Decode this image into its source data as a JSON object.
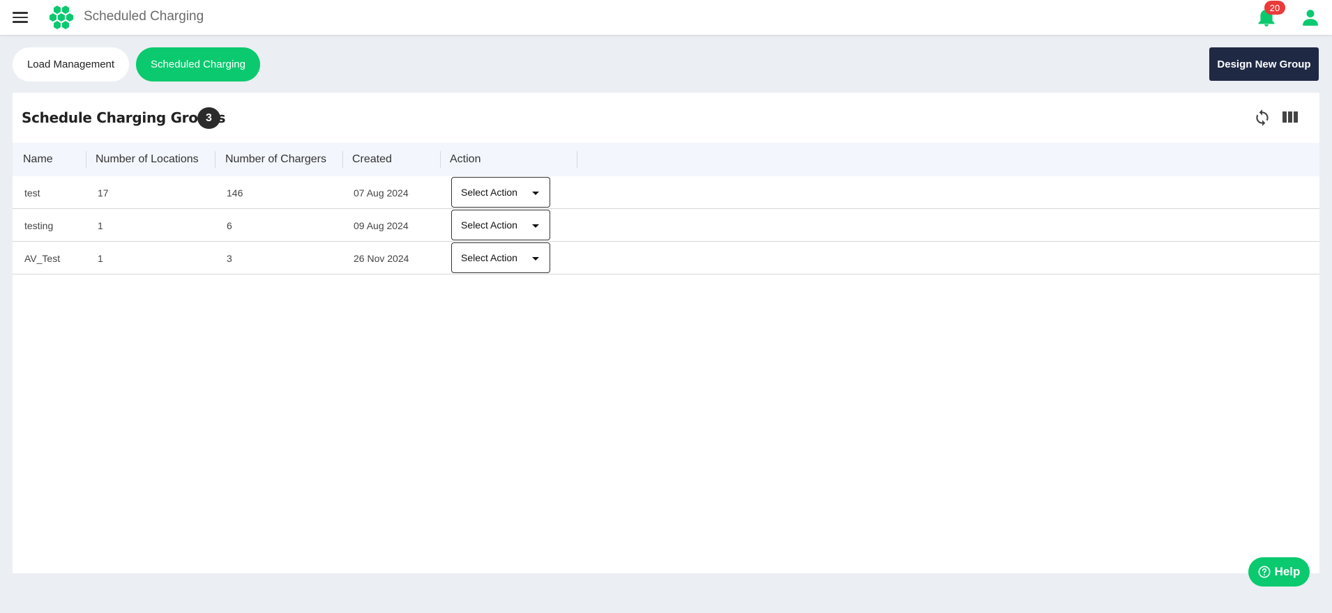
{
  "app": {
    "title": "Scheduled Charging",
    "notifications_count": "20"
  },
  "tabs": [
    {
      "label": "Load Management",
      "active": false
    },
    {
      "label": "Scheduled Charging",
      "active": true
    }
  ],
  "toolbar": {
    "design_new_group_label": "Design New Group"
  },
  "panel": {
    "title": "Schedule Charging Groups",
    "count": "3"
  },
  "table": {
    "columns": [
      "Name",
      "Number of Locations",
      "Number of Chargers",
      "Created",
      "Action"
    ],
    "rows": [
      {
        "name": "test",
        "locations": "17",
        "chargers": "146",
        "created": "07 Aug 2024",
        "action": "Select Action"
      },
      {
        "name": "testing",
        "locations": "1",
        "chargers": "6",
        "created": "09 Aug 2024",
        "action": "Select Action"
      },
      {
        "name": "AV_Test",
        "locations": "1",
        "chargers": "3",
        "created": "26 Nov 2024",
        "action": "Select Action"
      }
    ]
  },
  "help": {
    "label": "Help"
  },
  "colors": {
    "accent": "#0bc96f",
    "dark_button": "#1f2944",
    "badge_red": "#ea3a3a"
  },
  "icons": [
    "menu-icon",
    "logo-icon",
    "bell-icon",
    "user-icon",
    "refresh-icon",
    "columns-icon",
    "help-icon",
    "chevron-down-icon"
  ]
}
